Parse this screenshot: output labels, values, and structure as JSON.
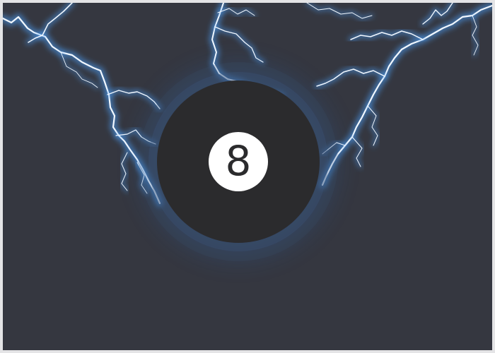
{
  "ball": {
    "number": "8"
  },
  "colors": {
    "background": "#353740",
    "frame": "#e4e4e6",
    "ball": "#2b2b2d",
    "number_disc": "#ffffff",
    "lightning_core": "#f2f8ff",
    "lightning_glow": "#4aa3ff"
  }
}
